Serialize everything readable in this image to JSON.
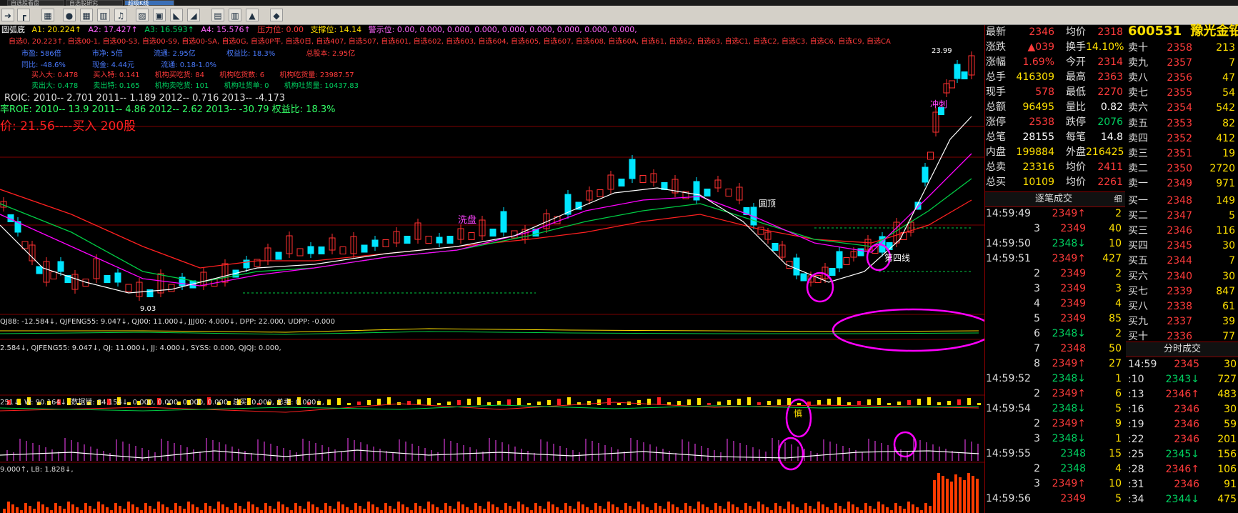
{
  "tabs": [
    {
      "label": "自选股看盘"
    },
    {
      "label": "自选股研究"
    },
    {
      "label": "超级K线"
    }
  ],
  "toolbar": {
    "icons": [
      "arrow-icon",
      "bar-icon",
      "grid-icon",
      "grid-icon",
      "bell-icon",
      "draw-icon",
      "image-icon",
      "measure-icon",
      "measure-icon",
      "doc-icon",
      "report-icon",
      "chart-icon",
      "diamond-icon"
    ]
  },
  "overlay": {
    "line1": {
      "name": "圆弧底",
      "a1": "A1: 20.224↑",
      "a2": "A2: 17.427↑",
      "a3": "A3: 16.593↑",
      "a4": "A4: 15.576↑",
      "press": "压力位: 0.00",
      "support": "支撑位: 14.14",
      "hint": "警示位: 0.00, 0.000, 0.000, 0.000, 0.000, 0.000, 0.000, 0.000, 0.000,"
    },
    "line2": "自选0, 20.223↑, 自选00-1, 自选00-S3, 自选00-S9, 自选00-SA, 自选0G, 自选0P平, 自选0日, 自选407, 自选507, 自选601, 自选602, 自选603, 自选604, 自选605, 自选607, 自选608, 自选60A, 自选61, 自选62, 自选63, 自选C1, 自选C2, 自选C3, 自选C6, 自选C9, 自选CA",
    "line3": {
      "a": "市盈: 586倍",
      "b": "市净: 5倍",
      "c": "流通: 2.95亿",
      "d": "权益比: 18.3%",
      "e": "总股本: 2.95亿"
    },
    "line4": {
      "a": "同比: -48.6%",
      "b": "现金: 4.44元",
      "c": "流通: 0.18-1.0%"
    },
    "line5": {
      "a": "买入大: 0.478",
      "b": "买入特: 0.141",
      "c": "机构买吃货: 84",
      "d": "机构吃货数: 6",
      "e": "机构吃货量: 23987.57"
    },
    "line6": {
      "a": "卖出大: 0.478",
      "b": "卖出特: 0.165",
      "c": "机构卖吃货: 101",
      "d": "机构吐货单: 0",
      "e": "机构吐货量: 10437.83"
    },
    "roic": "ROIC: 2010-- 2.701    2011-- 1.189    2012-- 0.716    2013-- -4.173",
    "roe": "率ROE: 2010-- 13.9    2011-- 4.86    2012-- 2.62    2013-- -30.79    权益比: 18.3%",
    "buy": "价: 21.56----买入 200股",
    "ann": {
      "wash": "洗盘",
      "arc": "圆顶",
      "fourth": "第四线",
      "price_low": "9.03",
      "price_high": "23.99",
      "cong": "冲刺",
      "shen": "慎"
    },
    "ind1": "QJ88: -12.584↓, QJFENG55: 9.047↓, QJ00: 11.000↓, JJJ00: 4.000↓, DPP: 22.000, UDPP: -0.000",
    "ind2": "2.584↓, QJFENG55: 9.047↓, QJ: 11.000↓, JJ: 4.000↓, SYSS: 0.000, QJQJ: 0.000,",
    "ind3": "251↓, W: 90.164↓, 数据锁: 84.154↓, 0.000, 0.000, 0.000, 0.000, 总买: 0.000, 总卖: 0.000↓,",
    "ind4": "9.000↑, LB: 1.828↓,"
  },
  "quote": {
    "code": "600531",
    "name": "豫光金铅",
    "left": [
      {
        "l": "最新",
        "v": "2346",
        "c": "red"
      },
      {
        "l": "涨跌",
        "v": "▲039",
        "c": "red"
      },
      {
        "l": "涨幅",
        "v": "1.69%",
        "c": "red"
      },
      {
        "l": "总手",
        "v": "416309",
        "c": "yellow"
      },
      {
        "l": "现手",
        "v": "578",
        "c": "red"
      },
      {
        "l": "总额",
        "v": "96495",
        "c": "yellow"
      },
      {
        "l": "涨停",
        "v": "2538",
        "c": "red"
      },
      {
        "l": "总笔",
        "v": "28155",
        "c": "white"
      },
      {
        "l": "内盘",
        "v": "199884",
        "c": "yellow"
      },
      {
        "l": "总卖",
        "v": "23316",
        "c": "yellow"
      },
      {
        "l": "总买",
        "v": "10109",
        "c": "yellow"
      }
    ],
    "right": [
      {
        "l": "均价",
        "v": "2318",
        "c": "red"
      },
      {
        "l": "换手",
        "v": "14.10%",
        "c": "yellow"
      },
      {
        "l": "今开",
        "v": "2314",
        "c": "red"
      },
      {
        "l": "最高",
        "v": "2363",
        "c": "red"
      },
      {
        "l": "最低",
        "v": "2270",
        "c": "red"
      },
      {
        "l": "量比",
        "v": "0.82",
        "c": "white"
      },
      {
        "l": "跌停",
        "v": "2076",
        "c": "green"
      },
      {
        "l": "每笔",
        "v": "14.8",
        "c": "white"
      },
      {
        "l": "外盘",
        "v": "216425",
        "c": "yellow"
      },
      {
        "l": "均价",
        "v": "2411",
        "c": "red"
      },
      {
        "l": "均价",
        "v": "2261",
        "c": "red"
      }
    ],
    "asks": [
      {
        "l": "卖十",
        "p": "2358",
        "q": "213",
        "c": "red"
      },
      {
        "l": "卖九",
        "p": "2357",
        "q": "7",
        "c": "red"
      },
      {
        "l": "卖八",
        "p": "2356",
        "q": "47",
        "c": "red"
      },
      {
        "l": "卖七",
        "p": "2355",
        "q": "54",
        "c": "red"
      },
      {
        "l": "卖六",
        "p": "2354",
        "q": "542",
        "c": "red"
      },
      {
        "l": "卖五",
        "p": "2353",
        "q": "82",
        "c": "red"
      },
      {
        "l": "卖四",
        "p": "2352",
        "q": "412",
        "c": "red"
      },
      {
        "l": "卖三",
        "p": "2351",
        "q": "19",
        "c": "red"
      },
      {
        "l": "卖二",
        "p": "2350",
        "q": "2720",
        "c": "red"
      },
      {
        "l": "卖一",
        "p": "2349",
        "q": "971",
        "c": "red"
      }
    ],
    "bids": [
      {
        "l": "买一",
        "p": "2348",
        "q": "149",
        "c": "red"
      },
      {
        "l": "买二",
        "p": "2347",
        "q": "5",
        "c": "red"
      },
      {
        "l": "买三",
        "p": "2346",
        "q": "116",
        "c": "red"
      },
      {
        "l": "买四",
        "p": "2345",
        "q": "30",
        "c": "red"
      },
      {
        "l": "买五",
        "p": "2344",
        "q": "7",
        "c": "red"
      },
      {
        "l": "买六",
        "p": "2340",
        "q": "30",
        "c": "red"
      },
      {
        "l": "买七",
        "p": "2339",
        "q": "847",
        "c": "red"
      },
      {
        "l": "买八",
        "p": "2338",
        "q": "61",
        "c": "red"
      },
      {
        "l": "买九",
        "p": "2337",
        "q": "39",
        "c": "red"
      },
      {
        "l": "买十",
        "p": "2336",
        "q": "77",
        "c": "red"
      }
    ],
    "ticks_header": "逐笔成交",
    "ticks_btn": "细",
    "ticks": [
      {
        "t": "14:59:49",
        "p": "2349↑",
        "q": "2",
        "c": "red"
      },
      {
        "t": "3",
        "p": "2349",
        "q": "40",
        "c": "red"
      },
      {
        "t": "14:59:50",
        "p": "2348↓",
        "q": "10",
        "c": "green"
      },
      {
        "t": "14:59:51",
        "p": "2349↑",
        "q": "427",
        "c": "red"
      },
      {
        "t": "2",
        "p": "2349",
        "q": "2",
        "c": "red"
      },
      {
        "t": "3",
        "p": "2349",
        "q": "3",
        "c": "red"
      },
      {
        "t": "4",
        "p": "2349",
        "q": "4",
        "c": "red"
      },
      {
        "t": "5",
        "p": "2349",
        "q": "85",
        "c": "red"
      },
      {
        "t": "6",
        "p": "2348↓",
        "q": "2",
        "c": "green"
      },
      {
        "t": "7",
        "p": "2348",
        "q": "50",
        "c": "red"
      },
      {
        "t": "8",
        "p": "2349↑",
        "q": "27",
        "c": "red"
      },
      {
        "t": "14:59:52",
        "p": "2348↓",
        "q": "1",
        "c": "green"
      },
      {
        "t": "2",
        "p": "2349↑",
        "q": "6",
        "c": "red"
      },
      {
        "t": "14:59:54",
        "p": "2348↓",
        "q": "5",
        "c": "green"
      },
      {
        "t": "2",
        "p": "2349↑",
        "q": "9",
        "c": "red"
      },
      {
        "t": "3",
        "p": "2348↓",
        "q": "1",
        "c": "green"
      },
      {
        "t": "14:59:55",
        "p": "2348",
        "q": "15",
        "c": "green"
      },
      {
        "t": "2",
        "p": "2348",
        "q": "4",
        "c": "green"
      },
      {
        "t": "3",
        "p": "2349↑",
        "q": "10",
        "c": "red"
      },
      {
        "t": "14:59:56",
        "p": "2349",
        "q": "5",
        "c": "red"
      }
    ],
    "min_header": "分时成交",
    "mins": [
      {
        "t": "14:59",
        "p": "2345",
        "q": "30",
        "c": "red"
      },
      {
        "t": ":10",
        "p": "2343↓",
        "q": "727",
        "c": "green"
      },
      {
        "t": ":13",
        "p": "2346↑",
        "q": "483",
        "c": "red"
      },
      {
        "t": ":16",
        "p": "2346",
        "q": "30",
        "c": "red"
      },
      {
        "t": ":19",
        "p": "2346",
        "q": "59",
        "c": "red"
      },
      {
        "t": ":22",
        "p": "2346",
        "q": "201",
        "c": "red"
      },
      {
        "t": ":25",
        "p": "2345↓",
        "q": "156",
        "c": "green"
      },
      {
        "t": ":28",
        "p": "2346↑",
        "q": "106",
        "c": "red"
      },
      {
        "t": ":31",
        "p": "2346",
        "q": "91",
        "c": "red"
      },
      {
        "t": ":34",
        "p": "2344↓",
        "q": "475",
        "c": "green"
      }
    ]
  }
}
